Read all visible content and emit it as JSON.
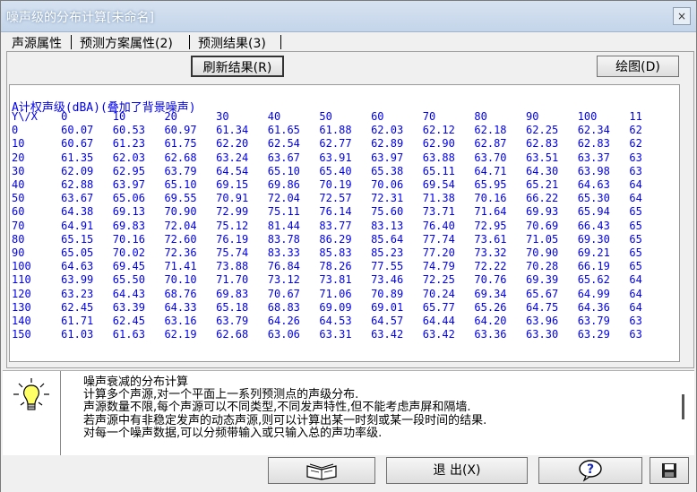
{
  "window": {
    "title": "噪声级的分布计算[未命名]",
    "close_label": "×"
  },
  "tabs": [
    {
      "label": "声源属性"
    },
    {
      "label": "预测方案属性(2)"
    },
    {
      "label": "预测结果(3)"
    }
  ],
  "toolbar": {
    "refresh_label": "刷新结果(R)",
    "plot_label": "绘图(D)"
  },
  "results": {
    "title": "A计权声级(dBA)(叠加了背景噪声)",
    "corner": "Y\\/X",
    "x_headers": [
      "0",
      "10",
      "20",
      "30",
      "40",
      "50",
      "60",
      "70",
      "80",
      "90",
      "100",
      "11"
    ],
    "rows": [
      {
        "y": "0",
        "v": [
          "60.07",
          "60.53",
          "60.97",
          "61.34",
          "61.65",
          "61.88",
          "62.03",
          "62.12",
          "62.18",
          "62.25",
          "62.34",
          "62"
        ]
      },
      {
        "y": "10",
        "v": [
          "60.67",
          "61.23",
          "61.75",
          "62.20",
          "62.54",
          "62.77",
          "62.89",
          "62.90",
          "62.87",
          "62.83",
          "62.83",
          "62"
        ]
      },
      {
        "y": "20",
        "v": [
          "61.35",
          "62.03",
          "62.68",
          "63.24",
          "63.67",
          "63.91",
          "63.97",
          "63.88",
          "63.70",
          "63.51",
          "63.37",
          "63"
        ]
      },
      {
        "y": "30",
        "v": [
          "62.09",
          "62.95",
          "63.79",
          "64.54",
          "65.10",
          "65.40",
          "65.38",
          "65.11",
          "64.71",
          "64.30",
          "63.98",
          "63"
        ]
      },
      {
        "y": "40",
        "v": [
          "62.88",
          "63.97",
          "65.10",
          "69.15",
          "69.86",
          "70.19",
          "70.06",
          "69.54",
          "65.95",
          "65.21",
          "64.63",
          "64"
        ]
      },
      {
        "y": "50",
        "v": [
          "63.67",
          "65.06",
          "69.55",
          "70.91",
          "72.04",
          "72.57",
          "72.31",
          "71.38",
          "70.16",
          "66.22",
          "65.30",
          "64"
        ]
      },
      {
        "y": "60",
        "v": [
          "64.38",
          "69.13",
          "70.90",
          "72.99",
          "75.11",
          "76.14",
          "75.60",
          "73.71",
          "71.64",
          "69.93",
          "65.94",
          "65"
        ]
      },
      {
        "y": "70",
        "v": [
          "64.91",
          "69.83",
          "72.04",
          "75.12",
          "81.44",
          "83.77",
          "83.13",
          "76.40",
          "72.95",
          "70.69",
          "66.43",
          "65"
        ]
      },
      {
        "y": "80",
        "v": [
          "65.15",
          "70.16",
          "72.60",
          "76.19",
          "83.78",
          "86.29",
          "85.64",
          "77.74",
          "73.61",
          "71.05",
          "69.30",
          "65"
        ]
      },
      {
        "y": "90",
        "v": [
          "65.05",
          "70.02",
          "72.36",
          "75.74",
          "83.33",
          "85.83",
          "85.23",
          "77.20",
          "73.32",
          "70.90",
          "69.21",
          "65"
        ]
      },
      {
        "y": "100",
        "v": [
          "64.63",
          "69.45",
          "71.41",
          "73.88",
          "76.84",
          "78.26",
          "77.55",
          "74.79",
          "72.22",
          "70.28",
          "66.19",
          "65"
        ]
      },
      {
        "y": "110",
        "v": [
          "63.99",
          "65.50",
          "70.10",
          "71.70",
          "73.12",
          "73.81",
          "73.46",
          "72.25",
          "70.76",
          "69.39",
          "65.62",
          "64"
        ]
      },
      {
        "y": "120",
        "v": [
          "63.23",
          "64.43",
          "68.76",
          "69.83",
          "70.67",
          "71.06",
          "70.89",
          "70.24",
          "69.34",
          "65.67",
          "64.99",
          "64"
        ]
      },
      {
        "y": "130",
        "v": [
          "62.45",
          "63.39",
          "64.33",
          "65.18",
          "68.83",
          "69.09",
          "69.01",
          "65.77",
          "65.26",
          "64.75",
          "64.36",
          "64"
        ]
      },
      {
        "y": "140",
        "v": [
          "61.71",
          "62.45",
          "63.16",
          "63.79",
          "64.26",
          "64.53",
          "64.57",
          "64.44",
          "64.20",
          "63.96",
          "63.79",
          "63"
        ]
      },
      {
        "y": "150",
        "v": [
          "61.03",
          "61.63",
          "62.19",
          "62.68",
          "63.06",
          "63.31",
          "63.42",
          "63.42",
          "63.36",
          "63.30",
          "63.29",
          "63"
        ]
      }
    ]
  },
  "info": {
    "lines": [
      "噪声衰减的分布计算",
      "计算多个声源,对一个平面上一系列预测点的声级分布.",
      "声源数量不限,每个声源可以不同类型,不同发声特性,但不能考虑声屏和隔墙.",
      "若声源中有非稳定发声的动态声源,则可以计算出某一时刻或某一段时间的结果.",
      "对每一个噪声数据,可以分频带输入或只输入总的声功率级."
    ]
  },
  "bottom": {
    "exit_label": "退 出(X)",
    "help_label": "?"
  },
  "colors": {
    "result_text": "#0000ee"
  }
}
